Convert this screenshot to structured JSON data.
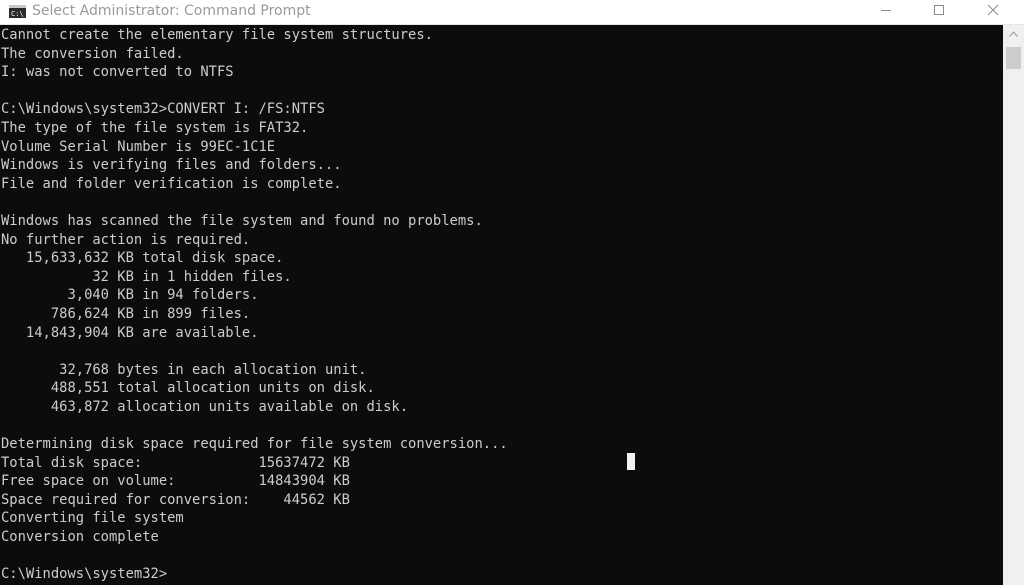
{
  "window": {
    "title": "Select Administrator: Command Prompt"
  },
  "icons": {
    "app": "cmd-icon",
    "minimize": "minimize-icon",
    "maximize": "maximize-icon",
    "close": "close-icon",
    "scroll_up": "chevron-up-icon"
  },
  "colors": {
    "console_background": "#0c0c0c",
    "console_text": "#cccccc",
    "titlebar_background": "#ffffff",
    "title_text": "#9a9a9a"
  },
  "console": {
    "lines": [
      "Cannot create the elementary file system structures.",
      "The conversion failed.",
      "I: was not converted to NTFS",
      "",
      "C:\\Windows\\system32>CONVERT I: /FS:NTFS",
      "The type of the file system is FAT32.",
      "Volume Serial Number is 99EC-1C1E",
      "Windows is verifying files and folders...",
      "File and folder verification is complete.",
      "",
      "Windows has scanned the file system and found no problems.",
      "No further action is required.",
      "   15,633,632 KB total disk space.",
      "           32 KB in 1 hidden files.",
      "        3,040 KB in 94 folders.",
      "      786,624 KB in 899 files.",
      "   14,843,904 KB are available.",
      "",
      "       32,768 bytes in each allocation unit.",
      "      488,551 total allocation units on disk.",
      "      463,872 allocation units available on disk.",
      "",
      "Determining disk space required for file system conversion...",
      "Total disk space:              15637472 KB",
      "Free space on volume:          14843904 KB",
      "Space required for conversion:    44562 KB",
      "Converting file system",
      "Conversion complete",
      "",
      "C:\\Windows\\system32>"
    ]
  }
}
